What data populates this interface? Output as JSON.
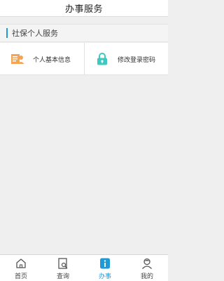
{
  "header": {
    "title": "办事服务"
  },
  "section": {
    "title": "社保个人服务"
  },
  "tiles": [
    {
      "label": "个人基本信息",
      "icon": "id-card-icon",
      "color": "#f5a454"
    },
    {
      "label": "修改登录密码",
      "icon": "lock-icon",
      "color": "#3ec8c0"
    }
  ],
  "tabbar": {
    "active": "办事",
    "accent": "#1e9ad6",
    "items": [
      {
        "label": "首页",
        "icon": "home-icon"
      },
      {
        "label": "查询",
        "icon": "search-document-icon"
      },
      {
        "label": "办事",
        "icon": "info-icon"
      },
      {
        "label": "我的",
        "icon": "user-icon"
      }
    ]
  }
}
